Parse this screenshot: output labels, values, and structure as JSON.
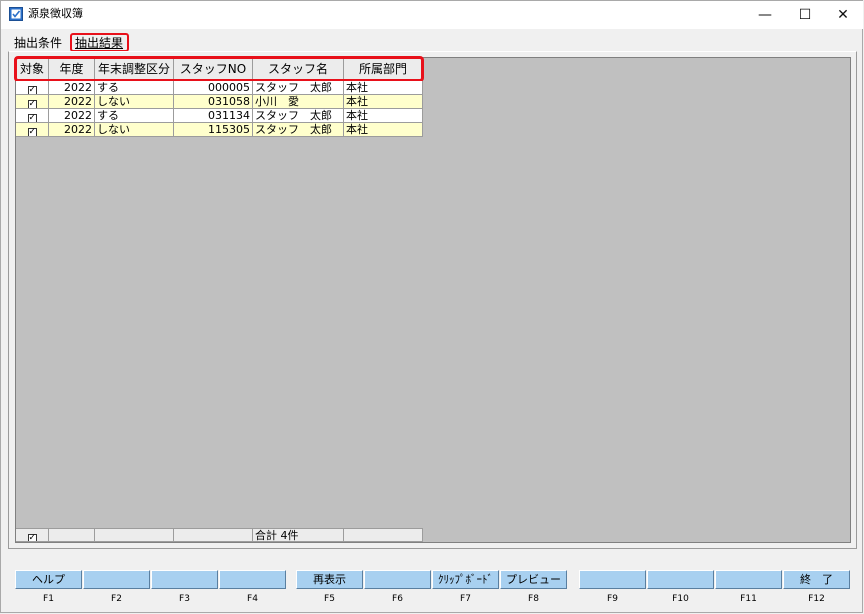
{
  "window": {
    "title": "源泉徴収簿",
    "controls": {
      "minimize": "—",
      "maximize": "☐",
      "close": "✕"
    }
  },
  "tabs": [
    {
      "label": "抽出条件"
    },
    {
      "label": "抽出結果"
    }
  ],
  "grid": {
    "columns": [
      "対象",
      "年度",
      "年末調整区分",
      "スタッフNO",
      "スタッフ名",
      "所属部門"
    ],
    "rows": [
      {
        "checked": "✓",
        "year": "2022",
        "adjust": "する",
        "staff_no": "000005",
        "staff_name": "スタッフ　太郎",
        "dept": "本社"
      },
      {
        "checked": "✓",
        "year": "2022",
        "adjust": "しない",
        "staff_no": "031058",
        "staff_name": "小川　愛",
        "dept": "本社"
      },
      {
        "checked": "✓",
        "year": "2022",
        "adjust": "する",
        "staff_no": "031134",
        "staff_name": "スタッフ　太郎",
        "dept": "本社"
      },
      {
        "checked": "✓",
        "year": "2022",
        "adjust": "しない",
        "staff_no": "115305",
        "staff_name": "スタッフ　太郎",
        "dept": "本社"
      }
    ],
    "row_colors": {
      "odd": "#ffffff",
      "even": "#ffffcc"
    },
    "footer": {
      "checked": "✓",
      "total": "合計 4件"
    }
  },
  "fkeys": [
    {
      "key": "F1",
      "label": "ヘルプ"
    },
    {
      "key": "F2",
      "label": ""
    },
    {
      "key": "F3",
      "label": ""
    },
    {
      "key": "F4",
      "label": ""
    },
    {
      "key": "F5",
      "label": "再表示"
    },
    {
      "key": "F6",
      "label": ""
    },
    {
      "key": "F7",
      "label": "ｸﾘｯﾌﾟﾎﾞｰﾄﾞ"
    },
    {
      "key": "F8",
      "label": "プレビュー"
    },
    {
      "key": "F9",
      "label": ""
    },
    {
      "key": "F10",
      "label": ""
    },
    {
      "key": "F11",
      "label": ""
    },
    {
      "key": "F12",
      "label": "終　了"
    }
  ],
  "colors": {
    "highlight": "#e8101a",
    "fkey_button": "#a8d0f0",
    "grid_background": "#c0c0c0"
  }
}
